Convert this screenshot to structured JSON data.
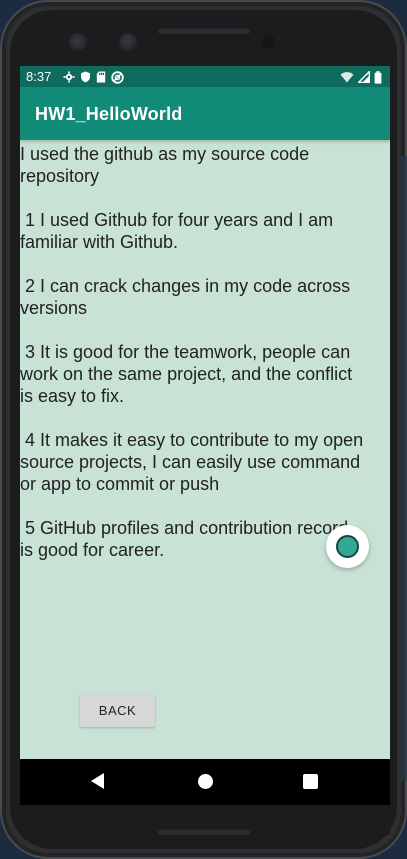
{
  "device": {
    "frame_color": "#2e2f31"
  },
  "status_bar": {
    "time": "8:37",
    "icons_left": [
      "gear-icon",
      "shield-icon",
      "sd-card-icon",
      "no-entry-icon"
    ],
    "icons_right": [
      "wifi-icon",
      "signal-icon",
      "battery-icon"
    ],
    "background": "#0e6b5e"
  },
  "app_bar": {
    "title": "HW1_HelloWorld",
    "background": "#128a78"
  },
  "content": {
    "background": "#c8e2d5",
    "paragraphs": [
      "I used the github as my source code repository",
      " 1 I used Github for four years and I am familiar with Github.",
      " 2 I can crack changes in my code across versions",
      " 3 It is good for the teamwork, people can work on the same project, and the conflict is easy to fix.",
      " 4 It makes it easy to contribute to my open source projects, I can easily use command or app to commit or push",
      " 5 GitHub profiles and contribution record is good for career."
    ]
  },
  "actions": {
    "back_label": "BACK"
  },
  "navigation": {
    "buttons": [
      "back-icon",
      "home-icon",
      "recents-icon"
    ]
  }
}
